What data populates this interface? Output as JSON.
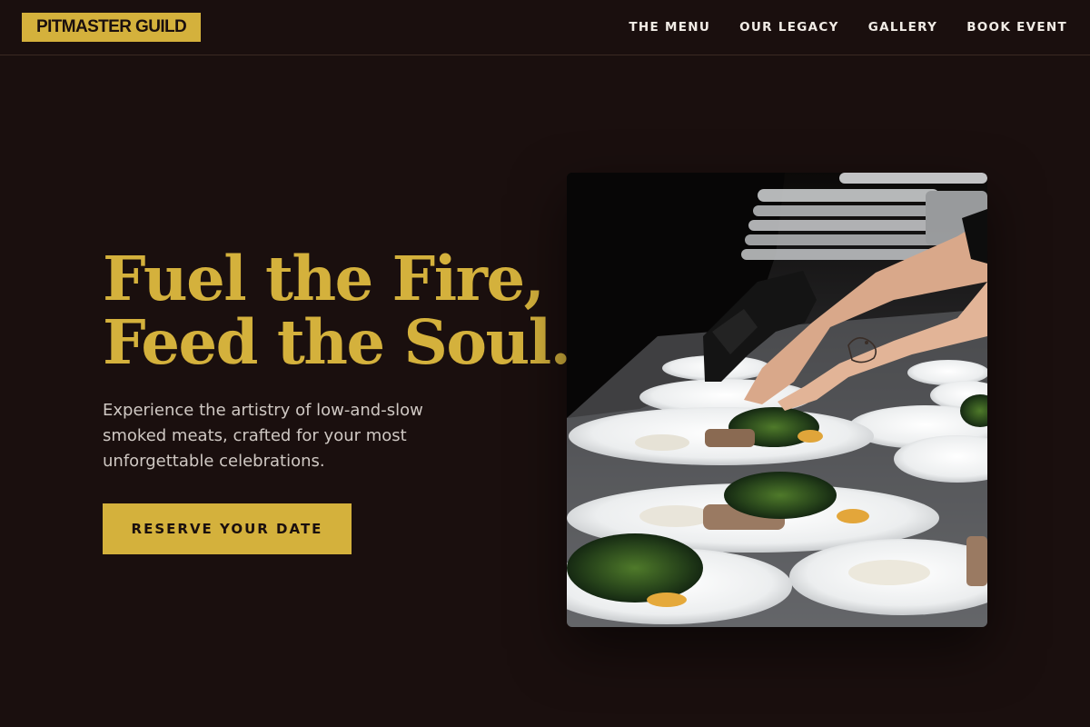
{
  "header": {
    "logo": "PITMASTER GUILD",
    "nav": [
      {
        "label": "THE MENU"
      },
      {
        "label": "OUR LEGACY"
      },
      {
        "label": "GALLERY"
      },
      {
        "label": "BOOK EVENT"
      }
    ]
  },
  "hero": {
    "title_line1": "Fuel the Fire,",
    "title_line2": "Feed the Soul.",
    "subtitle": "Experience the artistry of low-and-slow smoked meats, crafted for your most unforgettable celebrations.",
    "cta_label": "RESERVE YOUR DATE"
  },
  "colors": {
    "background": "#1a0f0e",
    "accent": "#d4b13c",
    "nav_text": "#f1ece6",
    "body_text": "#cfc8c3"
  }
}
